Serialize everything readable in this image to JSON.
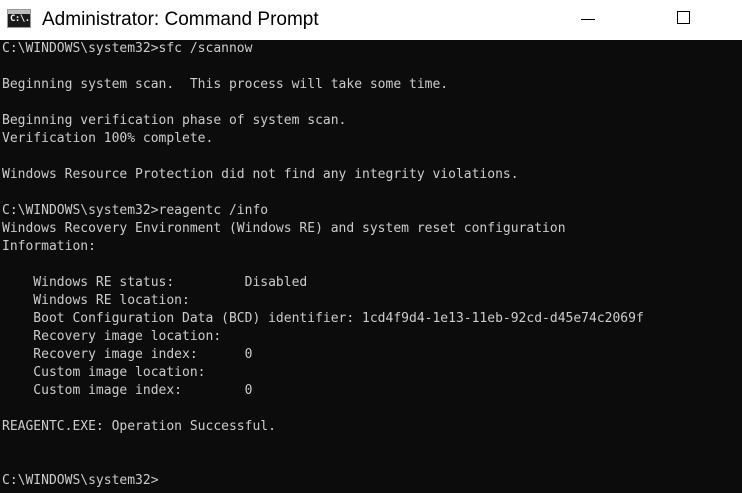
{
  "window": {
    "title": "Administrator: Command Prompt",
    "icon_label": "C:\\.",
    "icon": "command-prompt-icon",
    "controls": [
      "minimize-icon",
      "maximize-icon"
    ]
  },
  "colors": {
    "console_background": "#0c0c0c",
    "console_text": "#cccccc",
    "titlebar_background": "#ffffff"
  },
  "console": {
    "lines": [
      "C:\\WINDOWS\\system32>sfc /scannow",
      "",
      "Beginning system scan.  This process will take some time.",
      "",
      "Beginning verification phase of system scan.",
      "Verification 100% complete.",
      "",
      "Windows Resource Protection did not find any integrity violations.",
      "",
      "C:\\WINDOWS\\system32>reagentc /info",
      "Windows Recovery Environment (Windows RE) and system reset configuration",
      "Information:",
      "",
      "    Windows RE status:         Disabled",
      "    Windows RE location:",
      "    Boot Configuration Data (BCD) identifier: 1cd4f9d4-1e13-11eb-92cd-d45e74c2069f",
      "    Recovery image location:",
      "    Recovery image index:      0",
      "    Custom image location:",
      "    Custom image index:        0",
      "",
      "REAGENTC.EXE: Operation Successful.",
      "",
      "",
      "C:\\WINDOWS\\system32>"
    ]
  }
}
